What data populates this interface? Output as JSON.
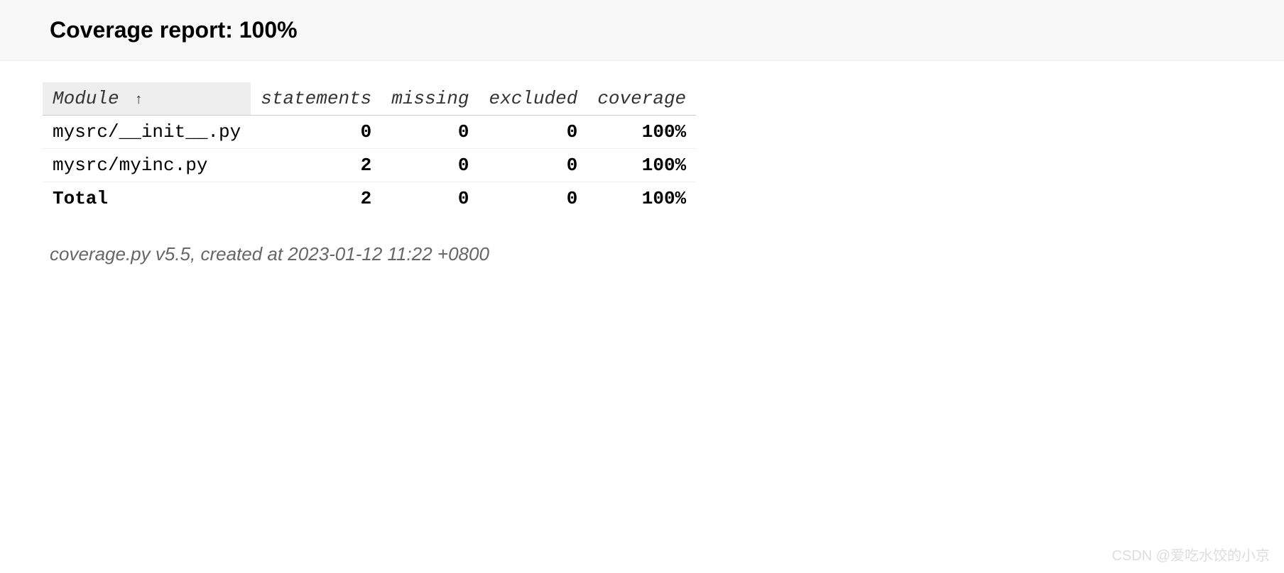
{
  "header": {
    "title_prefix": "Coverage report: ",
    "title_value": "100%"
  },
  "table": {
    "headers": {
      "module": "Module",
      "sort_arrow": "↑",
      "statements": "statements",
      "missing": "missing",
      "excluded": "excluded",
      "coverage": "coverage"
    },
    "rows": [
      {
        "module": "mysrc/__init__.py",
        "statements": "0",
        "missing": "0",
        "excluded": "0",
        "coverage": "100%"
      },
      {
        "module": "mysrc/myinc.py",
        "statements": "2",
        "missing": "0",
        "excluded": "0",
        "coverage": "100%"
      }
    ],
    "total": {
      "label": "Total",
      "statements": "2",
      "missing": "0",
      "excluded": "0",
      "coverage": "100%"
    }
  },
  "footer": {
    "text": "coverage.py v5.5, created at 2023-01-12 11:22 +0800"
  },
  "watermark": "CSDN @爱吃水饺的小京"
}
